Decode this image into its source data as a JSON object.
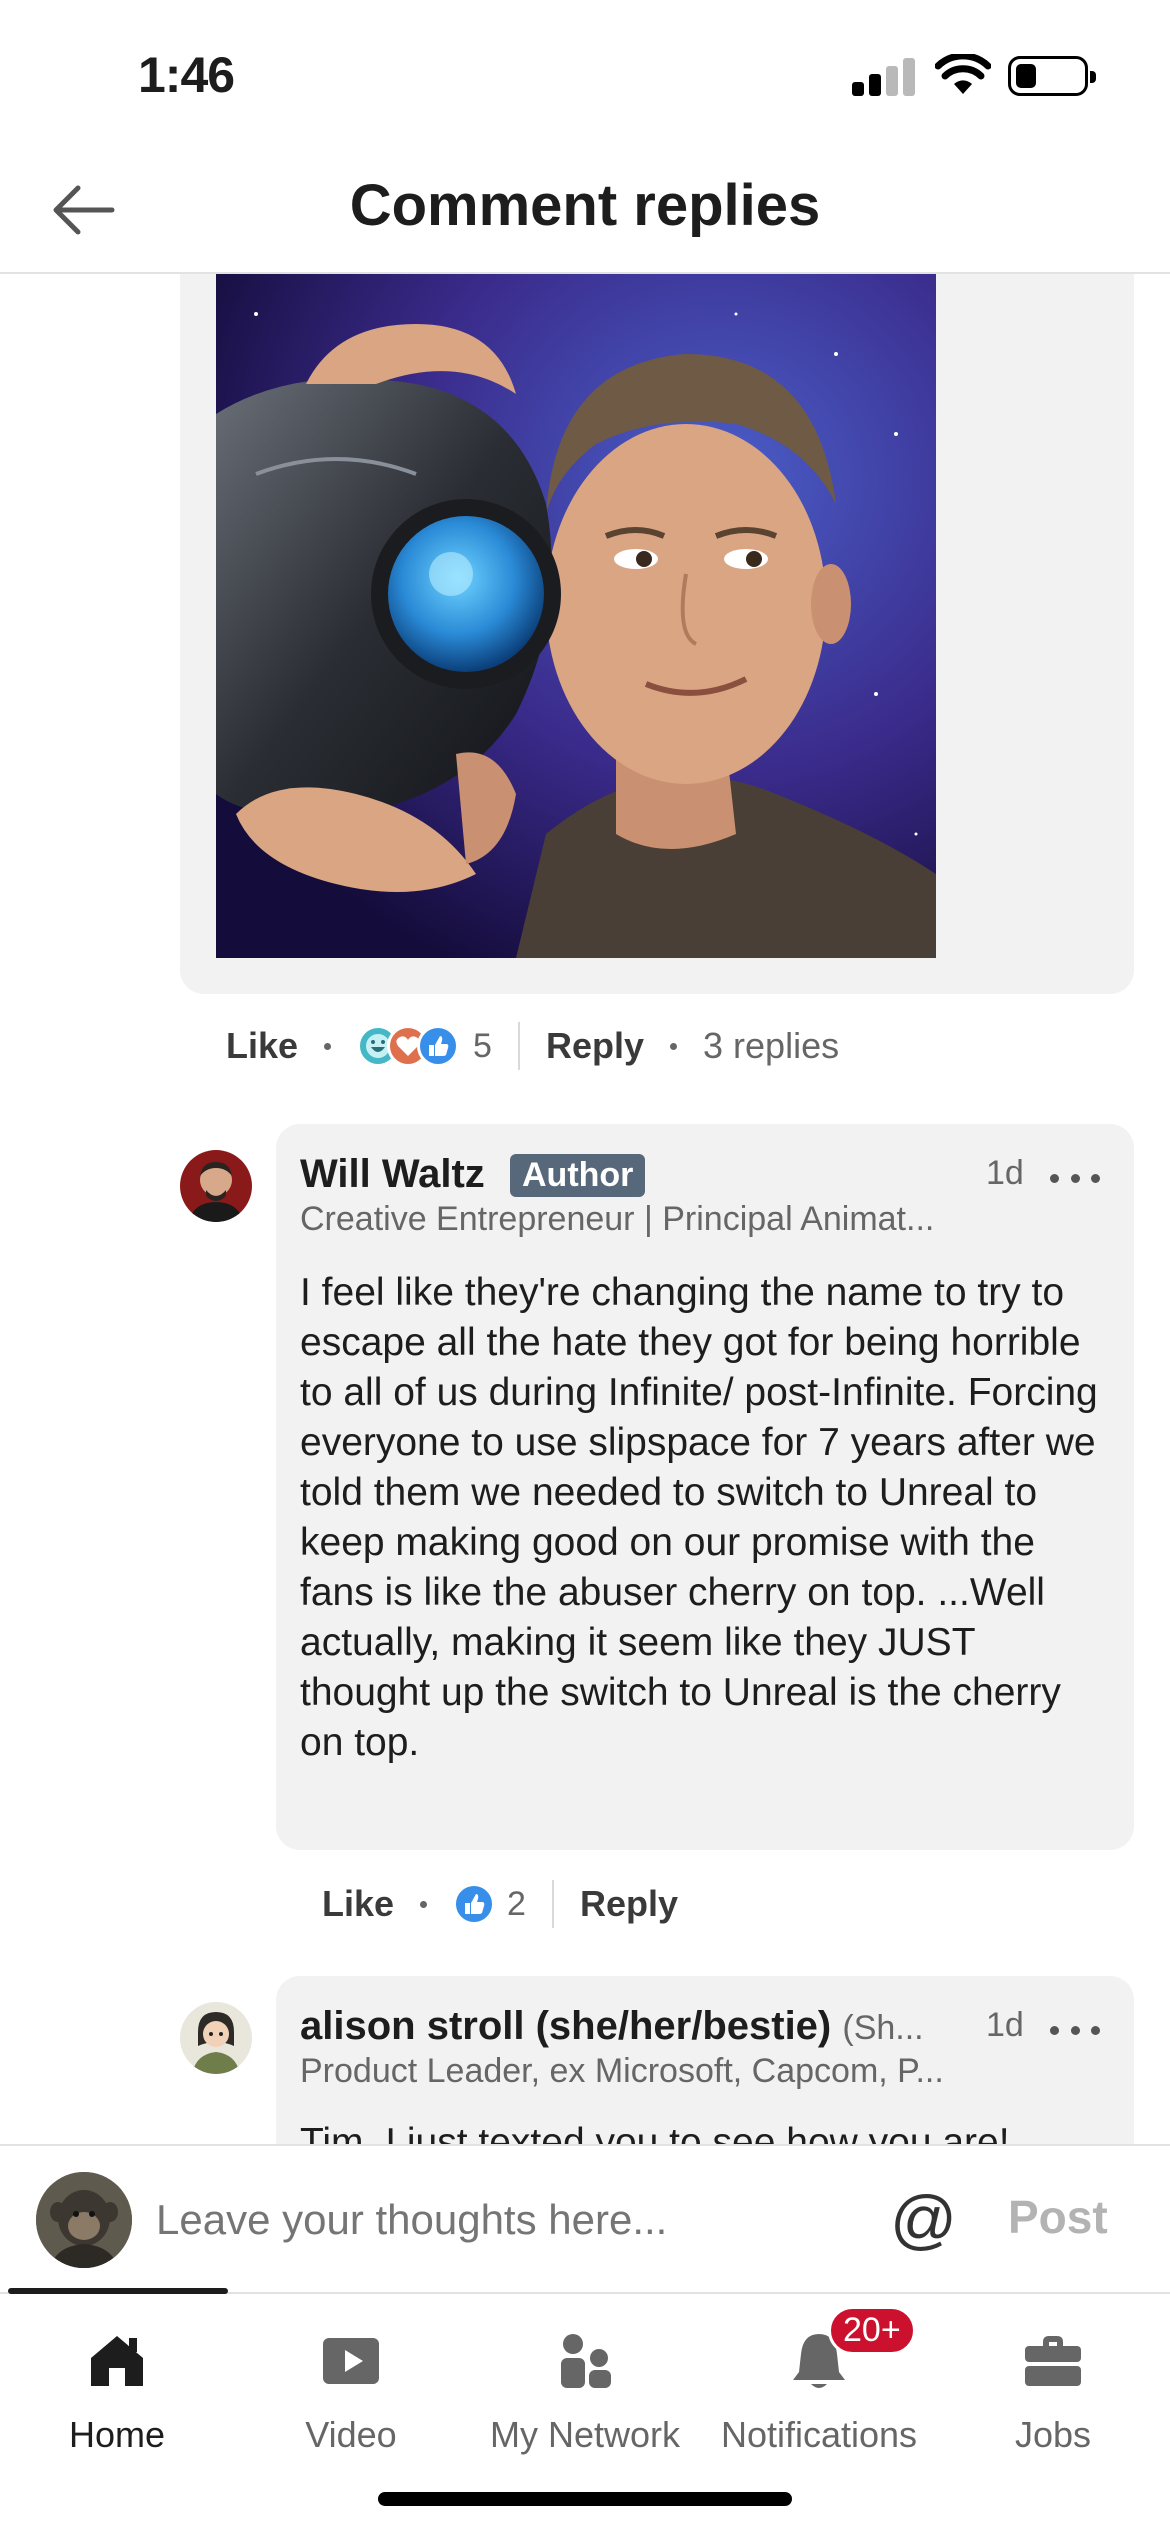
{
  "status_bar": {
    "time": "1:46"
  },
  "header": {
    "title": "Comment replies"
  },
  "parent_comment": {
    "like_label": "Like",
    "reaction_count": "5",
    "reply_label": "Reply",
    "replies_count": "3 replies",
    "reactions": [
      "funny-icon",
      "love-icon",
      "like-icon"
    ]
  },
  "replies": [
    {
      "name": "Will Waltz",
      "badge": "Author",
      "time": "1d",
      "headline": "Creative Entrepreneur | Principal Animat...",
      "text": "I feel like they're changing the name to try to escape all the hate they got for being horrible to all of us during Infinite/ post-Infinite. Forcing everyone to use slipspace for 7 years after we told them we needed to switch to Unreal to keep making good on our promise with the fans is like the abuser cherry on top. ...Well actually, making it seem like they JUST thought up the switch to Unreal is the cherry on top.",
      "like_label": "Like",
      "reaction_count": "2",
      "reply_label": "Reply"
    },
    {
      "name": "alison stroll (she/her/bestie)",
      "pronoun_suffix": "(Sh...",
      "time": "1d",
      "headline": "Product Leader, ex Microsoft, Capcom, P...",
      "text": "Tim, I just texted you to see how you are!"
    }
  ],
  "composer": {
    "placeholder": "Leave your thoughts here...",
    "at_symbol": "@",
    "post_label": "Post"
  },
  "bottom_nav": {
    "items": [
      {
        "label": "Home",
        "icon": "home-icon",
        "active": true
      },
      {
        "label": "Video",
        "icon": "video-icon"
      },
      {
        "label": "My Network",
        "icon": "network-icon"
      },
      {
        "label": "Notifications",
        "icon": "bell-icon",
        "badge": "20+"
      },
      {
        "label": "Jobs",
        "icon": "briefcase-icon"
      }
    ]
  },
  "colors": {
    "author_badge": "#56687a",
    "notification_badge": "#cb112d",
    "card_background": "#f2f2f2",
    "like_blue": "#378fe9"
  }
}
